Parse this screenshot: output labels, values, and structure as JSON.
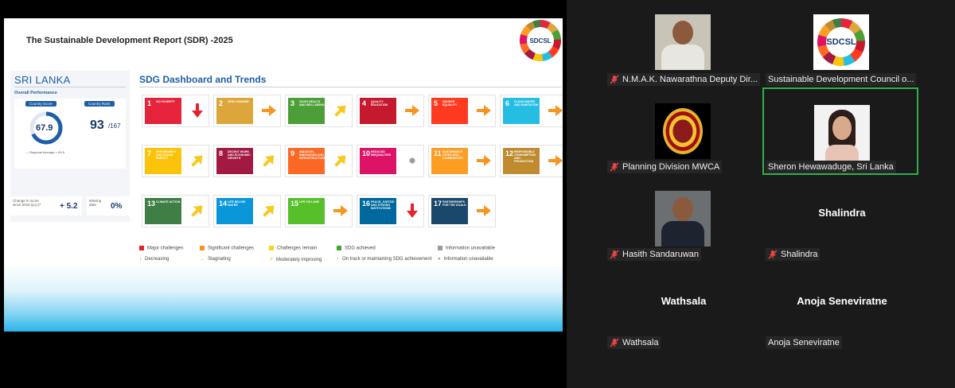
{
  "slide": {
    "title": "The Sustainable Development Report (SDR) -2025",
    "logo_text": "SDCSL",
    "country": "SRI LANKA",
    "overall_performance": "Overall Performance",
    "country_score_label": "Country Score",
    "country_score": "67.9",
    "regional_average": "— Regional Average = 69.5",
    "country_rank_label": "Country Rank",
    "country_rank": "93",
    "country_rank_total": "/167",
    "change_label": "Change in score since 2015 (p.p.)*",
    "change_value": "+ 5.2",
    "missing_label": "Missing data",
    "missing_value": "0%",
    "dashboard_title": "SDG Dashboard and Trends",
    "goals": [
      {
        "num": "1",
        "title": "NO POVERTY",
        "color": "#e5243b",
        "status": "Major challenges",
        "trend": "Decreasing"
      },
      {
        "num": "2",
        "title": "ZERO HUNGER",
        "color": "#dda63a",
        "status": "Major challenges",
        "trend": "Stagnating"
      },
      {
        "num": "3",
        "title": "GOOD HEALTH AND WELL-BEING",
        "color": "#4c9f38",
        "status": "Significant challenges",
        "trend": "Moderately improving"
      },
      {
        "num": "4",
        "title": "QUALITY EDUCATION",
        "color": "#c5192d",
        "status": "Significant challenges",
        "trend": "Stagnating"
      },
      {
        "num": "5",
        "title": "GENDER EQUALITY",
        "color": "#ff3a21",
        "status": "Major challenges",
        "trend": "Stagnating"
      },
      {
        "num": "6",
        "title": "CLEAN WATER AND SANITATION",
        "color": "#26bde2",
        "status": "Major challenges",
        "trend": "Stagnating"
      },
      {
        "num": "7",
        "title": "AFFORDABLE AND CLEAN ENERGY",
        "color": "#fcc30b",
        "status": "Significant challenges",
        "trend": "Moderately improving"
      },
      {
        "num": "8",
        "title": "DECENT WORK AND ECONOMIC GROWTH",
        "color": "#a21942",
        "status": "Significant challenges",
        "trend": "Moderately improving"
      },
      {
        "num": "9",
        "title": "INDUSTRY, INNOVATION AND INFRASTRUCTURE",
        "color": "#fd6925",
        "status": "Significant challenges",
        "trend": "Moderately improving"
      },
      {
        "num": "10",
        "title": "REDUCED INEQUALITIES",
        "color": "#dd1367",
        "status": "Significant challenges",
        "trend": "Information unavailable"
      },
      {
        "num": "11",
        "title": "SUSTAINABLE CITIES AND COMMUNITIES",
        "color": "#fd9d24",
        "status": "Significant challenges",
        "trend": "Stagnating"
      },
      {
        "num": "12",
        "title": "RESPONSIBLE CONSUMPTION AND PRODUCTION",
        "color": "#bf8b2e",
        "status": "Significant challenges",
        "trend": "Stagnating"
      },
      {
        "num": "13",
        "title": "CLIMATE ACTION",
        "color": "#3f7e44",
        "status": "SDG achieved",
        "trend": "Moderately improving"
      },
      {
        "num": "14",
        "title": "LIFE BELOW WATER",
        "color": "#0a97d9",
        "status": "Significant challenges",
        "trend": "Moderately improving"
      },
      {
        "num": "15",
        "title": "LIFE ON LAND",
        "color": "#56c02b",
        "status": "Major challenges",
        "trend": "Stagnating"
      },
      {
        "num": "16",
        "title": "PEACE, JUSTICE AND STRONG INSTITUTIONS",
        "color": "#00689d",
        "status": "Major challenges",
        "trend": "Decreasing"
      },
      {
        "num": "17",
        "title": "PARTNERSHIPS FOR THE GOALS",
        "color": "#19486a",
        "status": "Major challenges",
        "trend": "Stagnating"
      }
    ],
    "status_colors": {
      "Major challenges": "#e4232f",
      "Significant challenges": "#f7941e",
      "Challenges remain": "#f8d51d",
      "SDG achieved": "#3aa935",
      "Information unavailable": "#9b9b9b"
    },
    "trend_colors": {
      "Decreasing": "#e4232f",
      "Stagnating": "#f7941e",
      "Moderately improving": "#f8c81d",
      "On track or maintaining SDG achievement": "#3aa935",
      "Information unavailable": "#9b9b9b"
    },
    "legend_status": [
      "Major challenges",
      "Significant challenges",
      "Challenges remain",
      "SDG achieved",
      "Information unavailable"
    ],
    "legend_trend": [
      "Decreasing",
      "Stagnating",
      "Moderately improving",
      "On track or maintaining SDG achievement",
      "Information unavailable"
    ]
  },
  "participants": [
    {
      "name": "N.M.A.K. Nawarathna Deputy Dir...",
      "type": "photo-man",
      "muted": true,
      "active": false
    },
    {
      "name": "Sustainable Development Council o...",
      "type": "logo",
      "muted": false,
      "active": false
    },
    {
      "name": "Planning Division MWCA",
      "type": "emblem",
      "muted": true,
      "active": false
    },
    {
      "name": "Sheron Hewawaduge, Sri Lanka",
      "type": "photo-woman",
      "muted": false,
      "active": true
    },
    {
      "name": "Hasith Sandaruwan",
      "type": "photo-man2",
      "muted": true,
      "active": false
    },
    {
      "name": "Shalindra",
      "display": "Shalindra",
      "type": "text",
      "muted": true,
      "active": false
    },
    {
      "name": "Wathsala",
      "display": "Wathsala",
      "type": "text",
      "muted": true,
      "active": false
    },
    {
      "name": "Anoja Seneviratne",
      "display": "Anoja Seneviratne",
      "type": "text",
      "muted": false,
      "active": false
    }
  ],
  "icons": {
    "muted": "mic-muted-icon"
  }
}
